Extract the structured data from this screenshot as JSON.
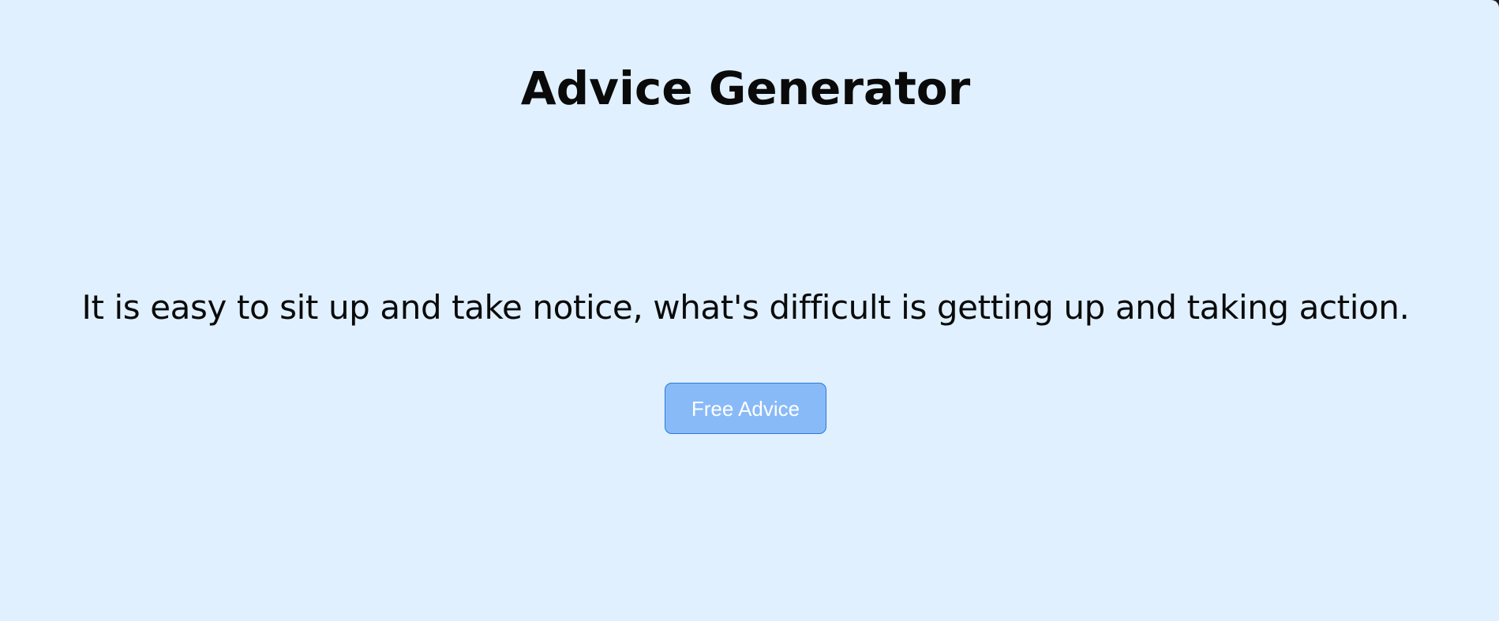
{
  "page": {
    "title": "Advice Generator",
    "background_color": "#e0f0fe"
  },
  "advice": {
    "text": "It is easy to sit up and take notice, what's difficult is getting up and taking action."
  },
  "actions": {
    "free_advice_label": "Free Advice",
    "button_color": "#89baf8",
    "button_border_color": "#2a7ad8"
  }
}
